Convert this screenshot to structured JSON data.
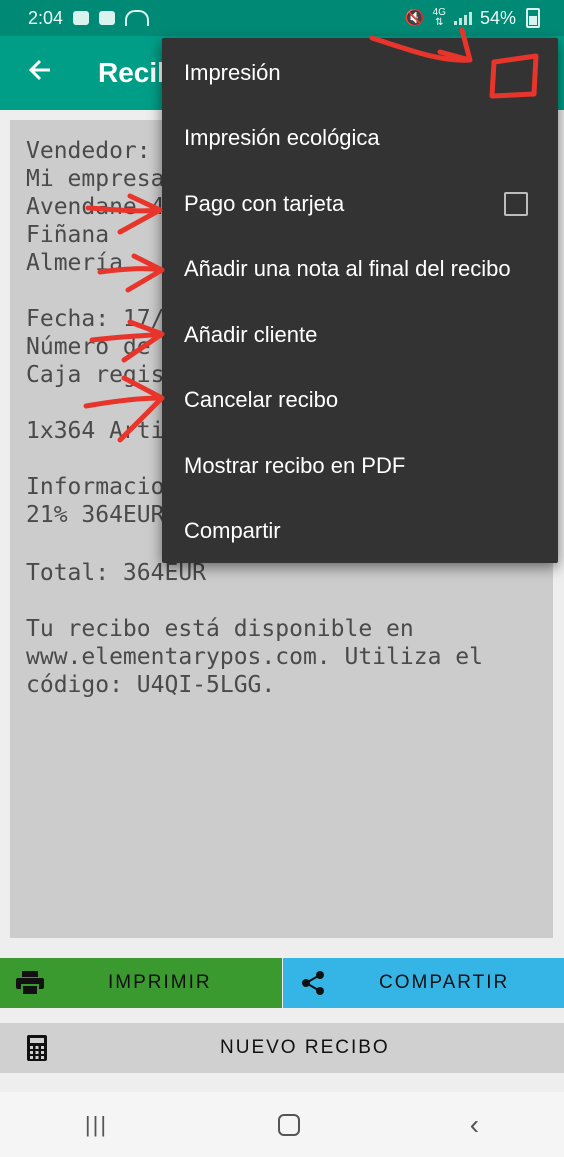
{
  "status_bar": {
    "time": "2:04",
    "network": "4G",
    "battery": "54%"
  },
  "appbar": {
    "title": "Recib"
  },
  "receipt": {
    "lines": [
      "Vendedor:",
      "Mi empresa",
      "Avendane 4",
      "Fiñana",
      "Almería",
      "",
      "Fecha: 17/",
      "Número de",
      "Caja regis",
      "",
      "1x364 Arti",
      "",
      "Informacio",
      "21% 364EUR",
      "",
      "Total: 364EUR",
      "",
      "Tu recibo está disponible en",
      "www.elementarypos.com. Utiliza el",
      "código: U4QI-5LGG."
    ]
  },
  "menu": {
    "items": [
      {
        "label": "Impresión"
      },
      {
        "label": "Impresión ecológica"
      },
      {
        "label": "Pago con tarjeta",
        "checkbox": false
      },
      {
        "label": "Añadir una nota al final del recibo"
      },
      {
        "label": "Añadir cliente"
      },
      {
        "label": "Cancelar recibo"
      },
      {
        "label": "Mostrar recibo en PDF"
      },
      {
        "label": "Compartir"
      }
    ]
  },
  "buttons": {
    "print": "IMPRIMIR",
    "share": "COMPARTIR",
    "new_receipt": "NUEVO RECIBO"
  },
  "colors": {
    "status_bar": "#008a76",
    "app_bar": "#009e87",
    "print_button": "#3a9a2f",
    "share_button": "#35b4e6",
    "menu_background": "#333333",
    "annotation": "#e8352b"
  },
  "icons": {
    "back": "arrow-left-icon",
    "print": "printer-icon",
    "share": "share-icon",
    "new_receipt": "calculator-icon"
  }
}
